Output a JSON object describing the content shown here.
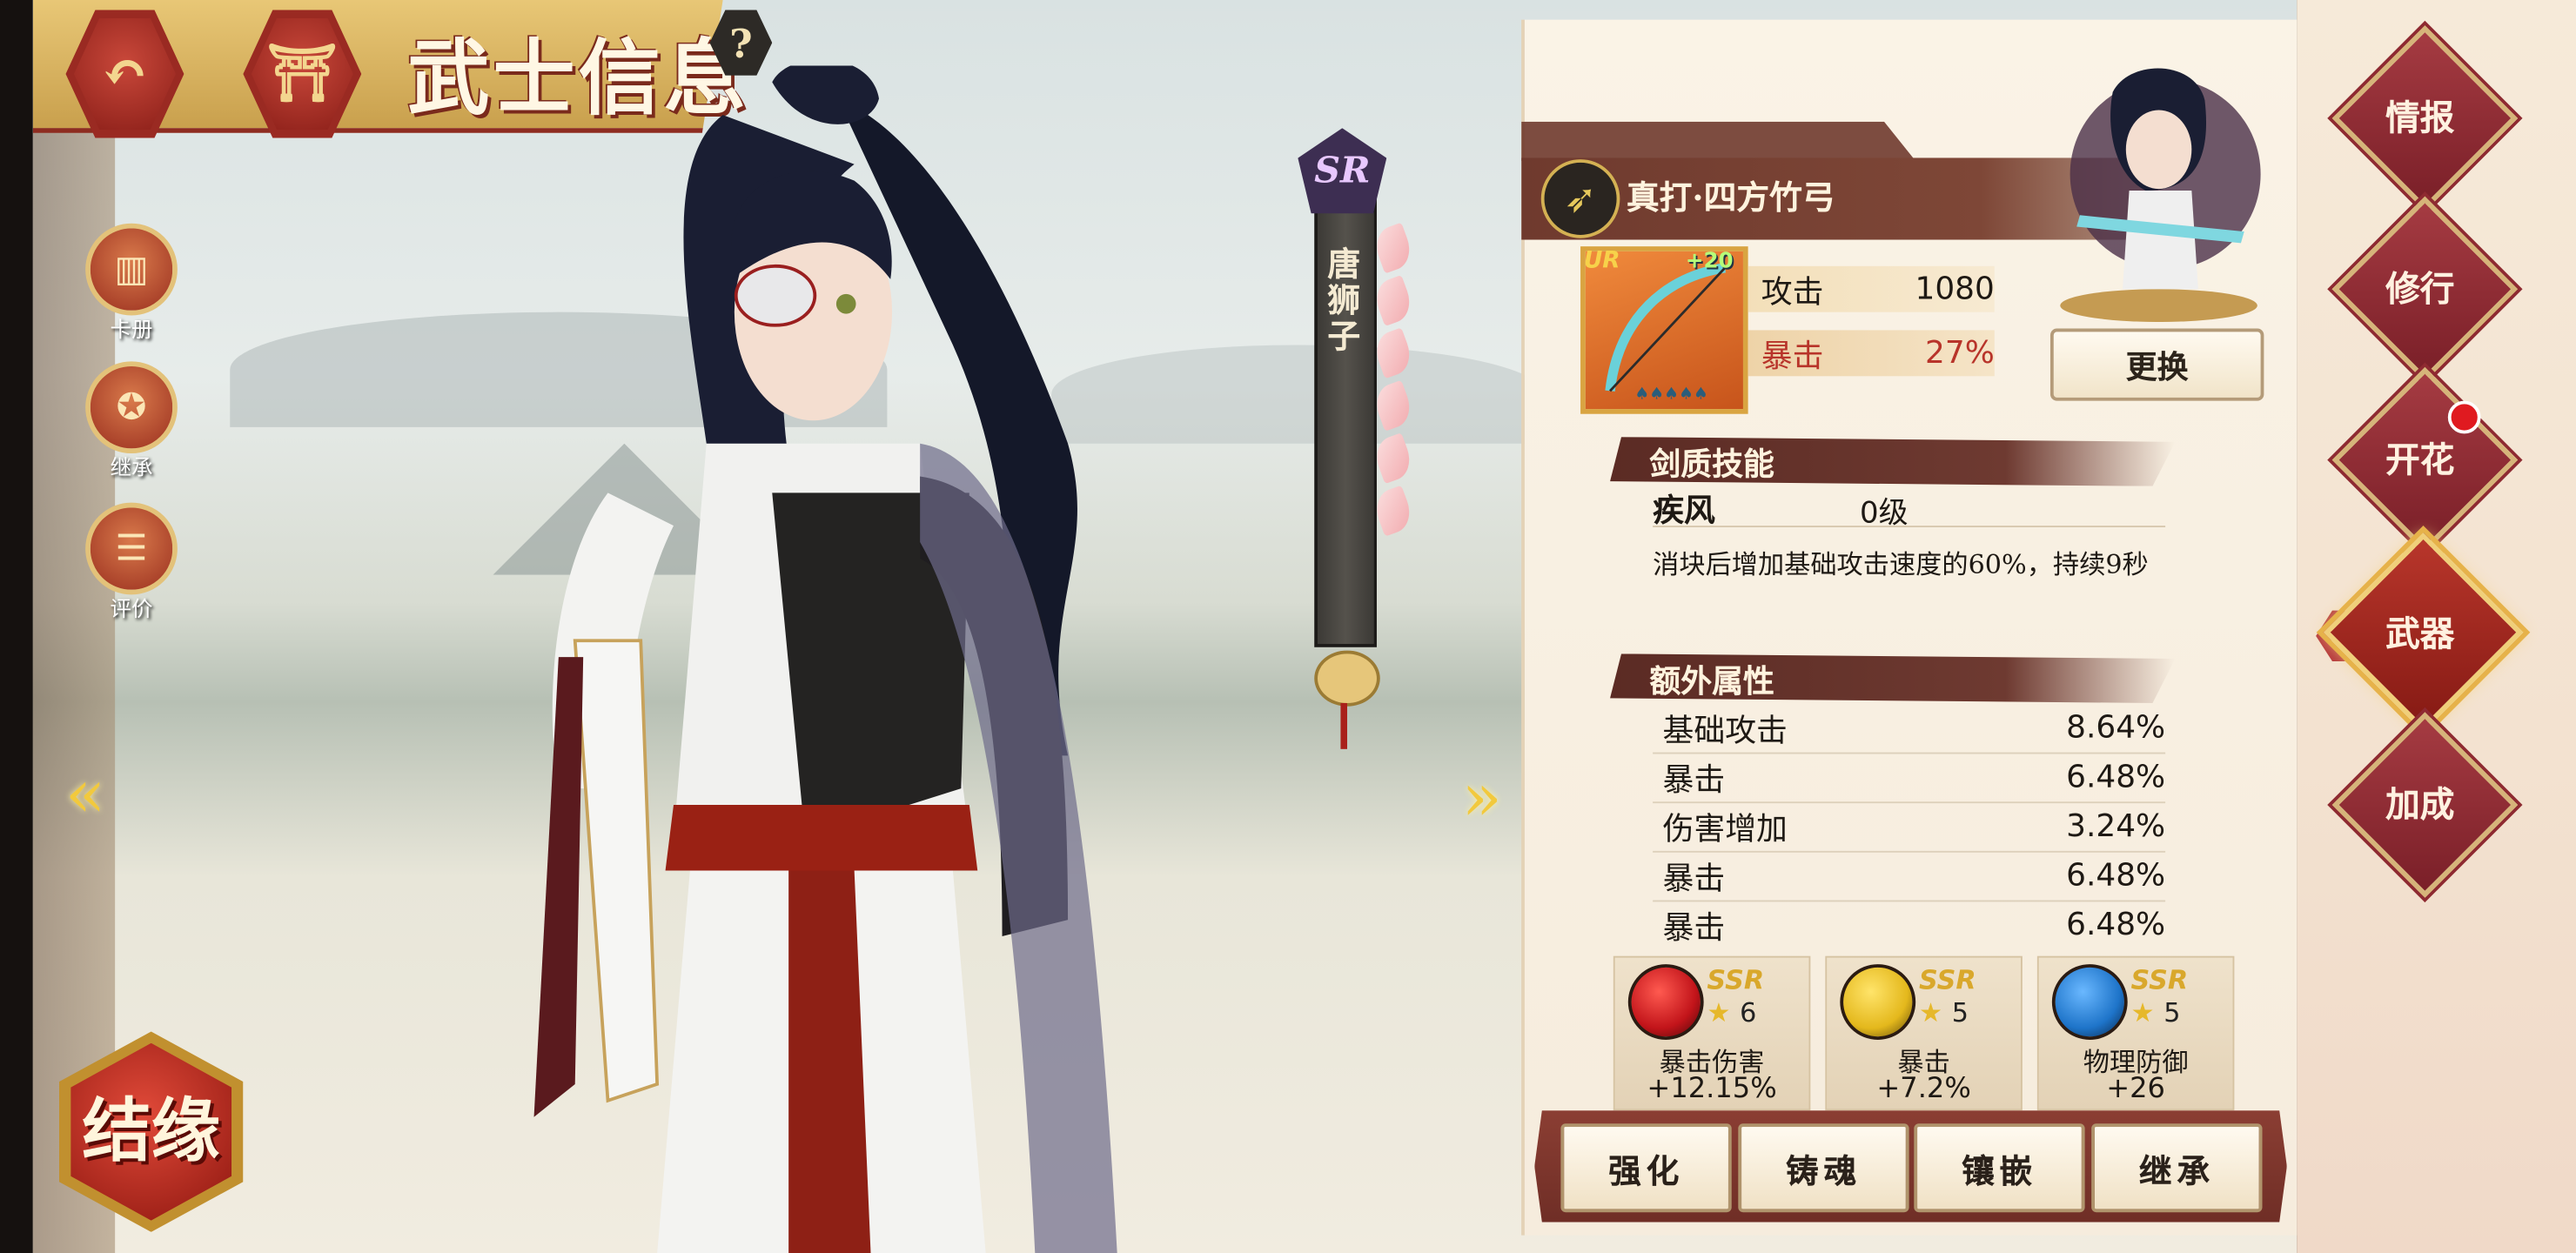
{
  "header": {
    "title": "武士信息",
    "back_icon": "↶",
    "home_icon": "⛩",
    "help_label": "?"
  },
  "left_menu": [
    {
      "label": "卡册",
      "icon": "card-album-icon",
      "glyph": "▥"
    },
    {
      "label": "继承",
      "icon": "pentagram-icon",
      "glyph": "✪"
    },
    {
      "label": "评价",
      "icon": "review-icon",
      "glyph": "☰"
    }
  ],
  "bond_button": {
    "label": "结缘"
  },
  "character": {
    "name": "唐狮子",
    "rarity": "SR",
    "petal_count": 6
  },
  "weapon": {
    "name": "真打·四方竹弓",
    "rarity": "UR",
    "refine": "+20",
    "stats": [
      {
        "label": "攻击",
        "value": "1080"
      },
      {
        "label": "暴击",
        "value": "27%"
      }
    ],
    "change_label": "更换"
  },
  "skill_section": {
    "header": "剑质技能",
    "skill_name": "疾风",
    "skill_level": "0级",
    "description": "消块后增加基础攻击速度的60%，持续9秒"
  },
  "extra_section": {
    "header": "额外属性",
    "rows": [
      {
        "label": "基础攻击",
        "value": "8.64%"
      },
      {
        "label": "暴击",
        "value": "6.48%"
      },
      {
        "label": "伤害增加",
        "value": "3.24%"
      },
      {
        "label": "暴击",
        "value": "6.48%"
      },
      {
        "label": "暴击",
        "value": "6.48%"
      }
    ]
  },
  "gems": [
    {
      "rarity": "SSR",
      "stars": "6",
      "name": "暴击伤害",
      "value": "+12.15%",
      "color": "#c2141a"
    },
    {
      "rarity": "SSR",
      "stars": "5",
      "name": "暴击",
      "value": "+7.2%",
      "color": "#e4b81c"
    },
    {
      "rarity": "SSR",
      "stars": "5",
      "name": "物理防御",
      "value": "+26",
      "color": "#1e74c9"
    }
  ],
  "actions": [
    "强化",
    "铸魂",
    "镶嵌",
    "继承"
  ],
  "right_menu": [
    {
      "label": "情报",
      "active": false
    },
    {
      "label": "修行",
      "active": false
    },
    {
      "label": "开花",
      "active": false,
      "notification": true
    },
    {
      "label": "武器",
      "active": true
    },
    {
      "label": "加成",
      "active": false
    }
  ],
  "colors": {
    "accent_red": "#8a1e18",
    "gold": "#d6b47a",
    "panel_bg": "#f6ecdd"
  }
}
